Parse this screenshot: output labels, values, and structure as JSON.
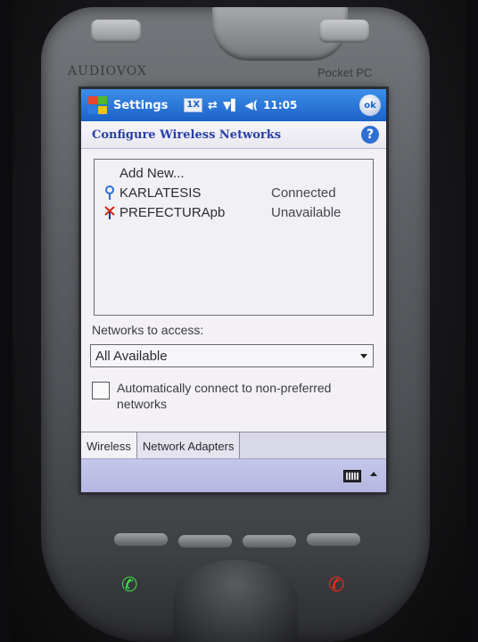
{
  "device": {
    "brand": "AUDIOVOX",
    "model": "Pocket PC"
  },
  "titlebar": {
    "title": "Settings",
    "network_badge": "1X",
    "time": "11:05",
    "ok_label": "ok"
  },
  "subheader": {
    "title": "Configure Wireless Networks",
    "help": "?"
  },
  "networks": {
    "add_new": "Add New...",
    "items": [
      {
        "name": "KARLATESIS",
        "status": "Connected"
      },
      {
        "name": "PREFECTURApb",
        "status": "Unavailable"
      }
    ]
  },
  "access": {
    "label": "Networks to access:",
    "selected": "All Available"
  },
  "auto_connect": {
    "label": "Automatically connect to non-preferred networks",
    "checked": false
  },
  "tabs": [
    {
      "label": "Wireless",
      "active": true
    },
    {
      "label": "Network Adapters",
      "active": false
    }
  ],
  "colors": {
    "titlebar": "#1d62c7",
    "menubar": "#b4b6e0",
    "subheader_text": "#283fa8"
  }
}
